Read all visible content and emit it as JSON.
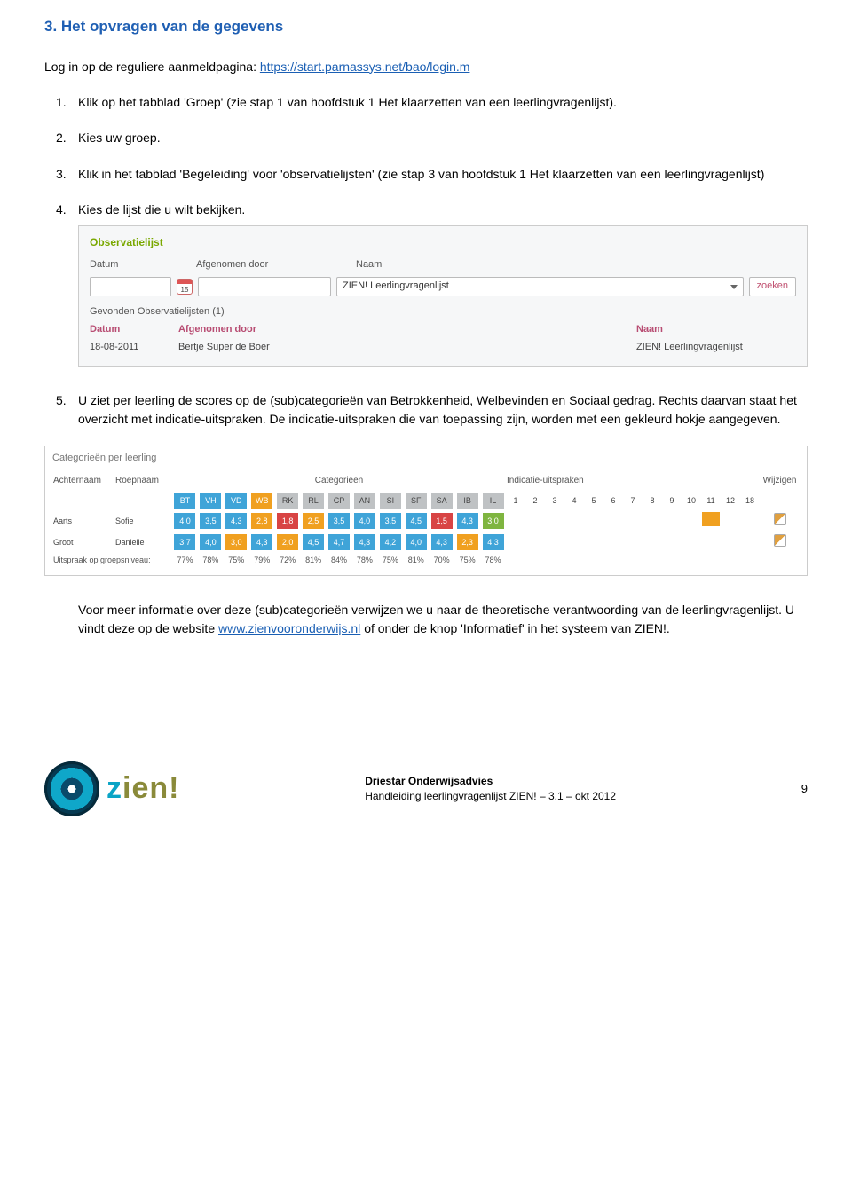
{
  "heading": "3. Het opvragen van de gegevens",
  "intro_prefix": "Log in op de reguliere aanmeldpagina: ",
  "intro_link": "https://start.parnassys.net/bao/login.m",
  "steps": {
    "s1": {
      "num": "1.",
      "text": "Klik op het tabblad 'Groep' (zie stap 1 van hoofdstuk 1 Het klaarzetten van een leerlingvragenlijst)."
    },
    "s2": {
      "num": "2.",
      "text": "Kies uw groep."
    },
    "s3": {
      "num": "3.",
      "text": "Klik in het tabblad 'Begeleiding' voor 'observatielijsten' (zie stap 3 van hoofdstuk 1 Het klaarzetten van een leerlingvragenlijst)"
    },
    "s4": {
      "num": "4.",
      "text": "Kies de lijst die u wilt bekijken."
    },
    "s5": {
      "num": "5.",
      "text": "U ziet per leerling de scores op de (sub)categorieën van Betrokkenheid, Welbevinden en Sociaal gedrag. Rechts daarvan staat het overzicht met indicatie-uitspraken. De indicatie-uitspraken die van toepassing zijn, worden met een gekleurd hokje aangegeven."
    }
  },
  "panel1": {
    "title": "Observatielijst",
    "hdr_datum": "Datum",
    "hdr_afg": "Afgenomen door",
    "hdr_naam": "Naam",
    "select_value": "ZIEN! Leerlingvragenlijst",
    "btn": "zoeken",
    "found": "Gevonden Observatielijsten (1)",
    "rh_datum": "Datum",
    "rh_afg": "Afgenomen door",
    "rh_naam": "Naam",
    "row_date": "18-08-2011",
    "row_by": "Bertje Super de Boer",
    "row_name": "ZIEN! Leerlingvragenlijst"
  },
  "scores": {
    "title": "Categorieën per leerling",
    "col_achternaam": "Achternaam",
    "col_roepnaam": "Roepnaam",
    "col_cat": "Categorieën",
    "col_ind": "Indicatie-uitspraken",
    "col_wijz": "Wijzigen",
    "cats": [
      "BT",
      "VH",
      "VD",
      "WB",
      "RK",
      "RL",
      "CP",
      "AN",
      "SI",
      "SF",
      "SA",
      "IB",
      "IL"
    ],
    "inds": [
      "1",
      "2",
      "3",
      "4",
      "5",
      "6",
      "7",
      "8",
      "9",
      "10",
      "11",
      "12",
      "18"
    ],
    "rows": [
      {
        "achternaam": "Aarts",
        "roepnaam": "Sofie",
        "vals": [
          "4,0",
          "3,5",
          "4,3",
          "2,8",
          "1,8",
          "2,5",
          "3,5",
          "4,0",
          "3,5",
          "4,5",
          "1,5",
          "4,3",
          "3,0"
        ],
        "colors": [
          "#3fa4d8",
          "#3fa4d8",
          "#3fa4d8",
          "#f0a020",
          "#d84444",
          "#f0a020",
          "#3fa4d8",
          "#3fa4d8",
          "#3fa4d8",
          "#3fa4d8",
          "#d84444",
          "#3fa4d8",
          "#7fb540"
        ],
        "ind_on": [
          10
        ]
      },
      {
        "achternaam": "Groot",
        "roepnaam": "Danielle",
        "vals": [
          "3,7",
          "4,0",
          "3,0",
          "4,3",
          "2,0",
          "4,5",
          "4,7",
          "4,3",
          "4,2",
          "4,0",
          "4,3",
          "2,3",
          "4,3"
        ],
        "colors": [
          "#3fa4d8",
          "#3fa4d8",
          "#f0a020",
          "#3fa4d8",
          "#f0a020",
          "#3fa4d8",
          "#3fa4d8",
          "#3fa4d8",
          "#3fa4d8",
          "#3fa4d8",
          "#3fa4d8",
          "#f0a020",
          "#3fa4d8"
        ],
        "ind_on": []
      }
    ],
    "pct_label": "Uitspraak op groepsniveau:",
    "pcts": [
      "77%",
      "78%",
      "75%",
      "79%",
      "72%",
      "81%",
      "84%",
      "78%",
      "75%",
      "81%",
      "70%",
      "75%",
      "78%"
    ]
  },
  "after": {
    "p1a": "Voor meer informatie over deze (sub)categorieën verwijzen we u naar de theoretische verantwoording van de leerlingvragenlijst. U vindt deze op de website ",
    "link": "www.zienvooronderwijs.nl",
    "p1b": " of onder de knop 'Informatief' in het systeem van ZIEN!."
  },
  "footer": {
    "logo_z": "z",
    "logo_rest": "ien!",
    "line1": "Driestar Onderwijsadvies",
    "line2": "Handleiding leerlingvragenlijst ZIEN! – 3.1 – okt 2012",
    "page": "9"
  }
}
